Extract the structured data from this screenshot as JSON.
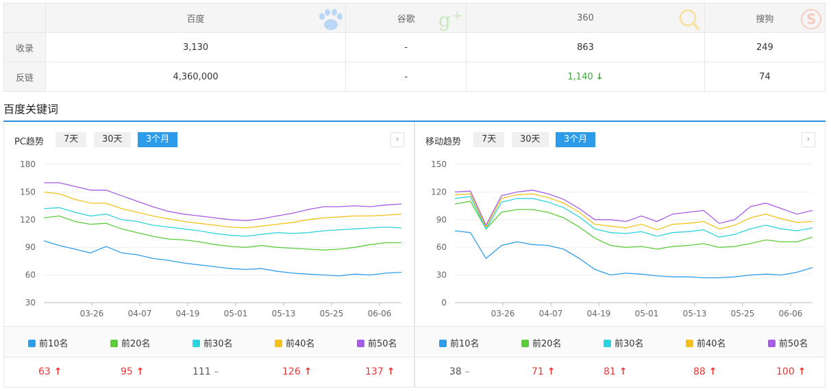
{
  "stats": {
    "engines": [
      "百度",
      "谷歌",
      "360",
      "搜狗"
    ],
    "rows": [
      {
        "label": "收录",
        "values": [
          "3,130",
          "-",
          "863",
          "249"
        ]
      },
      {
        "label": "反链",
        "values": [
          "4,360,000",
          "-",
          "1,140",
          "74"
        ]
      }
    ],
    "trend_arrow": "↓"
  },
  "section_title": "百度关键词",
  "ranges": [
    "7天",
    "30天",
    "3个月"
  ],
  "active_range": "3个月",
  "colors": {
    "top10": "#2e9ee8",
    "top20": "#5ccc3a",
    "top30": "#2dd3dc",
    "top40": "#f3c21a",
    "top50": "#a65ce6",
    "accent": "#2b9bea"
  },
  "legend": [
    "前10名",
    "前20名",
    "前30名",
    "前40名",
    "前50名"
  ],
  "x_ticks": [
    "03-26",
    "04-07",
    "04-19",
    "05-01",
    "05-13",
    "05-25",
    "06-06"
  ],
  "pc": {
    "title": "PC趋势",
    "y_ticks": [
      "180",
      "150",
      "120",
      "90",
      "60",
      "30"
    ],
    "values": [
      {
        "text": "63",
        "trend": "up"
      },
      {
        "text": "95",
        "trend": "up"
      },
      {
        "text": "111",
        "trend": "flat"
      },
      {
        "text": "126",
        "trend": "up"
      },
      {
        "text": "137",
        "trend": "up"
      }
    ]
  },
  "mobile": {
    "title": "移动趋势",
    "y_ticks": [
      "150",
      "120",
      "90",
      "60",
      "30",
      "0"
    ],
    "values": [
      {
        "text": "38",
        "trend": "flat"
      },
      {
        "text": "71",
        "trend": "up"
      },
      {
        "text": "81",
        "trend": "up"
      },
      {
        "text": "88",
        "trend": "up"
      },
      {
        "text": "100",
        "trend": "up"
      }
    ]
  },
  "chart_data": [
    {
      "type": "line",
      "title": "PC趋势",
      "ylim": [
        30,
        180
      ],
      "x_ticks": [
        "03-26",
        "04-07",
        "04-19",
        "05-01",
        "05-13",
        "05-25",
        "06-06"
      ],
      "series": [
        {
          "name": "前10名",
          "values": [
            97,
            92,
            88,
            84,
            91,
            84,
            82,
            78,
            76,
            73,
            71,
            69,
            67,
            66,
            67,
            64,
            62,
            61,
            60,
            59,
            61,
            60,
            62,
            63
          ]
        },
        {
          "name": "前20名",
          "values": [
            122,
            124,
            118,
            115,
            116,
            110,
            106,
            102,
            99,
            98,
            96,
            93,
            91,
            90,
            92,
            90,
            89,
            88,
            87,
            88,
            90,
            93,
            95,
            95
          ]
        },
        {
          "name": "前30名",
          "values": [
            132,
            133,
            128,
            124,
            126,
            120,
            118,
            114,
            112,
            110,
            108,
            105,
            103,
            102,
            104,
            106,
            105,
            106,
            108,
            109,
            110,
            111,
            112,
            111
          ]
        },
        {
          "name": "前40名",
          "values": [
            150,
            148,
            142,
            138,
            138,
            132,
            128,
            124,
            121,
            118,
            116,
            114,
            112,
            111,
            113,
            115,
            117,
            120,
            122,
            123,
            124,
            124,
            125,
            126
          ]
        },
        {
          "name": "前50名",
          "values": [
            160,
            160,
            156,
            152,
            152,
            146,
            140,
            134,
            129,
            126,
            124,
            122,
            120,
            119,
            121,
            124,
            127,
            131,
            134,
            134,
            135,
            134,
            136,
            137
          ]
        }
      ]
    },
    {
      "type": "line",
      "title": "移动趋势",
      "ylim": [
        0,
        150
      ],
      "x_ticks": [
        "03-26",
        "04-07",
        "04-19",
        "05-01",
        "05-13",
        "05-25",
        "06-06"
      ],
      "series": [
        {
          "name": "前10名",
          "values": [
            78,
            76,
            48,
            62,
            66,
            63,
            62,
            58,
            48,
            36,
            30,
            32,
            31,
            29,
            28,
            28,
            27,
            27,
            28,
            30,
            31,
            30,
            33,
            38
          ]
        },
        {
          "name": "前20名",
          "values": [
            107,
            110,
            80,
            98,
            101,
            101,
            98,
            92,
            82,
            70,
            62,
            60,
            61,
            58,
            61,
            62,
            64,
            60,
            61,
            64,
            68,
            66,
            66,
            71
          ]
        },
        {
          "name": "前30名",
          "values": [
            113,
            115,
            80,
            109,
            113,
            113,
            109,
            103,
            93,
            80,
            76,
            75,
            77,
            72,
            76,
            77,
            79,
            71,
            74,
            80,
            84,
            80,
            78,
            81
          ]
        },
        {
          "name": "前40名",
          "values": [
            117,
            118,
            82,
            113,
            117,
            118,
            114,
            108,
            98,
            85,
            83,
            81,
            85,
            79,
            85,
            86,
            88,
            80,
            84,
            92,
            96,
            91,
            87,
            88
          ]
        },
        {
          "name": "前50名",
          "values": [
            120,
            121,
            84,
            116,
            120,
            122,
            118,
            112,
            102,
            90,
            90,
            88,
            94,
            88,
            96,
            98,
            100,
            86,
            90,
            104,
            108,
            102,
            96,
            100
          ]
        }
      ]
    }
  ]
}
